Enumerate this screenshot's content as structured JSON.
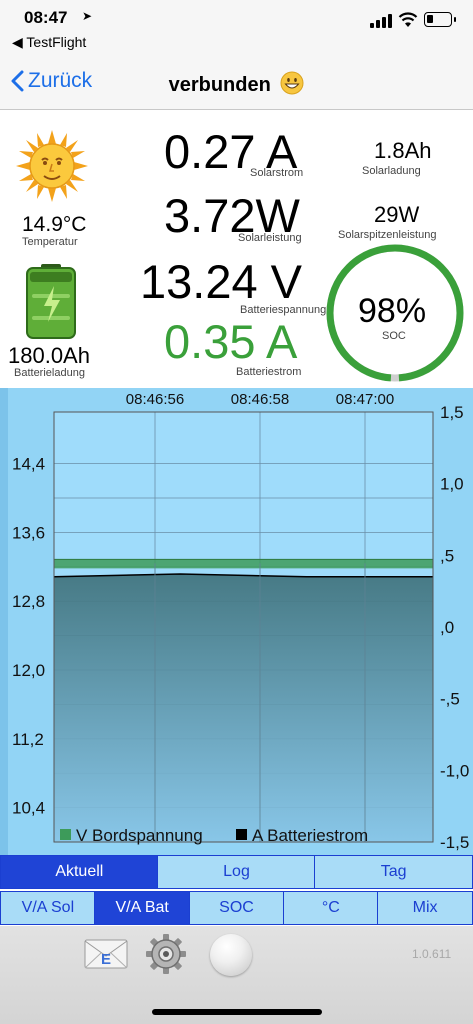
{
  "status_bar": {
    "time": "08:47",
    "back_app": "◀ TestFlight"
  },
  "nav": {
    "back_label": "Zurück",
    "title": "verbunden"
  },
  "readings": {
    "temperature": {
      "value": "14.9°C",
      "label": "Temperatur"
    },
    "battery_charge": {
      "value": "180.0Ah",
      "label": "Batterieladung"
    },
    "solar_current": {
      "value": "0.27 A",
      "label": "Solarstrom"
    },
    "solar_power": {
      "value": "3.72W",
      "label": "Solarleistung"
    },
    "battery_voltage": {
      "value": "13.24 V",
      "label": "Batteriespannung"
    },
    "battery_current": {
      "value": "0.35 A",
      "label": "Batteriestrom"
    },
    "solar_charge": {
      "value": "1.8Ah",
      "label": "Solarladung"
    },
    "solar_peak": {
      "value": "29W",
      "label": "Solarspitzenleistung"
    },
    "soc": {
      "value": "98%",
      "label": "SOC",
      "fraction": 0.98
    }
  },
  "chart_data": {
    "type": "area",
    "x_labels": [
      "08:46:56",
      "08:46:58",
      "08:47:00"
    ],
    "y_left_ticks": [
      "14,4",
      "13,6",
      "12,8",
      "12,0",
      "11,2",
      "10,4"
    ],
    "y_left_values": [
      14.4,
      13.6,
      12.8,
      12.0,
      11.2,
      10.4
    ],
    "y_right_ticks": [
      "1,5",
      "1,0",
      ",5",
      ",0",
      "-,5",
      "-1,0",
      "-1,5"
    ],
    "y_right_values": [
      1.5,
      1.0,
      0.5,
      0.0,
      -0.5,
      -1.0,
      -1.5
    ],
    "ylim_left": [
      10.0,
      15.0
    ],
    "ylim_right": [
      -1.5,
      1.5
    ],
    "series": [
      {
        "name": "V Bordspannung",
        "axis": "left",
        "color": "#3d9b5a",
        "values": [
          13.24,
          13.24,
          13.24,
          13.24,
          13.24,
          13.24,
          13.24
        ]
      },
      {
        "name": "A Batteriestrom",
        "axis": "right",
        "color": "#000000",
        "values": [
          0.35,
          0.36,
          0.37,
          0.36,
          0.35,
          0.35,
          0.35
        ]
      }
    ],
    "legend_position": "bottom"
  },
  "tabs_row1": [
    "Aktuell",
    "Log",
    "Tag"
  ],
  "tabs_row1_active": 0,
  "tabs_row2": [
    "V/A Sol",
    "V/A Bat",
    "SOC",
    "°C",
    "Mix"
  ],
  "tabs_row2_active": 1,
  "toolbar": {
    "version": "1.0.611",
    "icons": [
      "mail-icon",
      "gear-icon",
      "ball-icon"
    ]
  },
  "colors": {
    "accent": "#1f44d6",
    "chart_bg": "#92d4f5",
    "voltage_green": "#3aa03a"
  }
}
